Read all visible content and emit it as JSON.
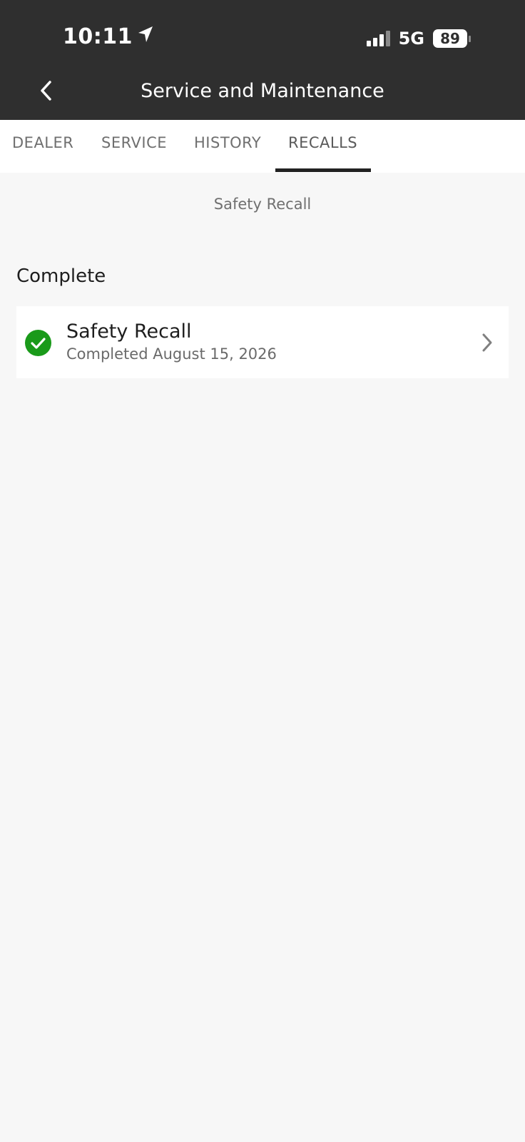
{
  "status_bar": {
    "time": "10:11",
    "network": "5G",
    "battery": "89"
  },
  "nav": {
    "title": "Service and Maintenance"
  },
  "tabs": [
    {
      "label": "DEALER"
    },
    {
      "label": "SERVICE"
    },
    {
      "label": "HISTORY"
    },
    {
      "label": "RECALLS",
      "active": true
    }
  ],
  "page": {
    "subtitle": "Safety Recall",
    "section_heading": "Complete"
  },
  "recalls": [
    {
      "title": "Safety Recall",
      "status": "Completed August 15, 2026",
      "icon": "check-circle-icon"
    }
  ],
  "colors": {
    "header_bg": "#2f2f2f",
    "page_bg": "#f7f7f7",
    "success_green": "#1a9a1a",
    "tab_indicator": "#222222"
  }
}
